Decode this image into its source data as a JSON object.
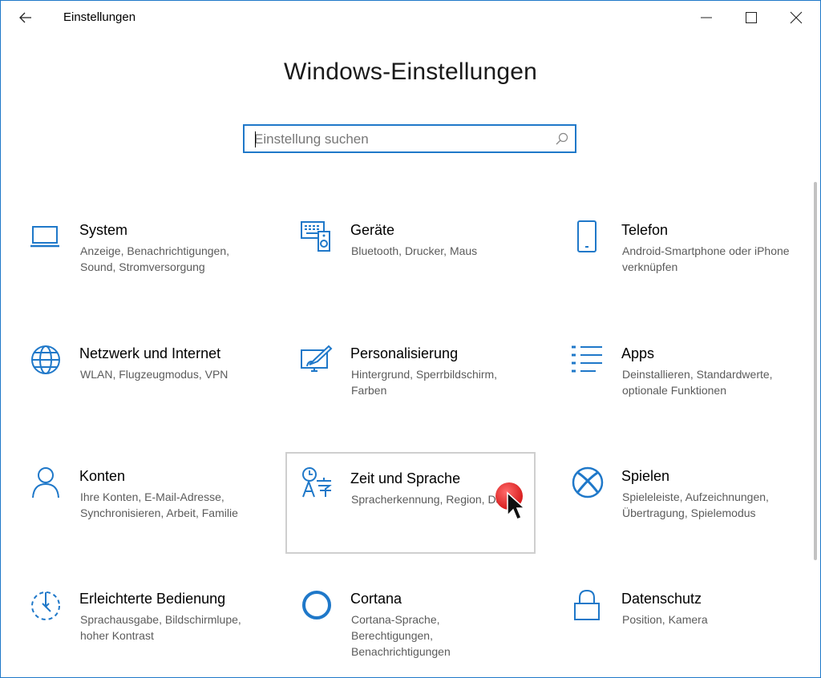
{
  "window": {
    "title": "Einstellungen",
    "accent": "#1f78c9"
  },
  "page": {
    "title": "Windows-Einstellungen"
  },
  "search": {
    "placeholder": "Einstellung suchen"
  },
  "tiles": [
    {
      "title": "System",
      "desc": "Anzeige, Benachrichtigungen, Sound, Stromversorgung",
      "icon": "laptop-icon"
    },
    {
      "title": "Geräte",
      "desc": "Bluetooth, Drucker, Maus",
      "icon": "devices-icon"
    },
    {
      "title": "Telefon",
      "desc": "Android-Smartphone oder iPhone verknüpfen",
      "icon": "phone-icon"
    },
    {
      "title": "Netzwerk und Internet",
      "desc": "WLAN, Flugzeugmodus, VPN",
      "icon": "globe-icon"
    },
    {
      "title": "Personalisierung",
      "desc": "Hintergrund, Sperrbildschirm, Farben",
      "icon": "paint-icon"
    },
    {
      "title": "Apps",
      "desc": "Deinstallieren, Standardwerte, optionale Funktionen",
      "icon": "apps-list-icon"
    },
    {
      "title": "Konten",
      "desc": "Ihre Konten, E-Mail-Adresse, Synchronisieren, Arbeit, Familie",
      "icon": "person-icon"
    },
    {
      "title": "Zeit und Sprache",
      "desc": "Spracherkennung, Region, Datum",
      "icon": "time-language-icon"
    },
    {
      "title": "Spielen",
      "desc": "Spieleleiste, Aufzeichnungen, Übertragung, Spielemodus",
      "icon": "xbox-icon"
    },
    {
      "title": "Erleichterte Bedienung",
      "desc": "Sprachausgabe, Bildschirmlupe, hoher Kontrast",
      "icon": "ease-of-access-icon"
    },
    {
      "title": "Cortana",
      "desc": "Cortana-Sprache, Berechtigungen, Benachrichtigungen",
      "icon": "cortana-icon"
    },
    {
      "title": "Datenschutz",
      "desc": "Position, Kamera",
      "icon": "lock-icon"
    }
  ]
}
